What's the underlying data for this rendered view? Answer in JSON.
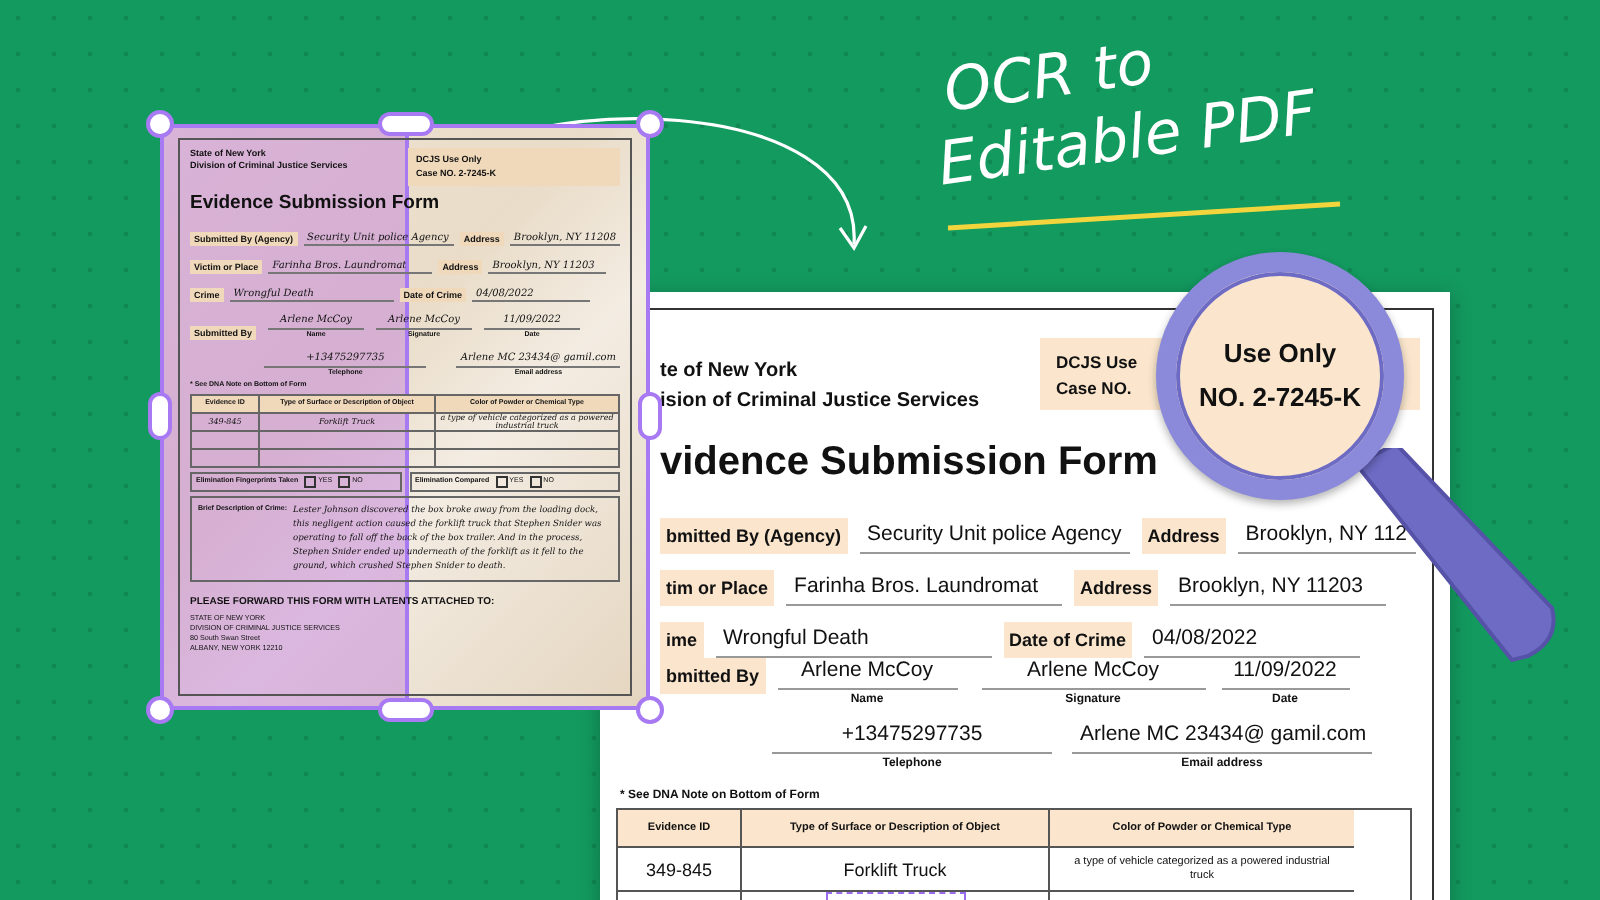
{
  "headline": {
    "lines": [
      "OCR to",
      "Editable PDF"
    ]
  },
  "scan": {
    "header_left": [
      "State of New York",
      "Division of Criminal Justice Services"
    ],
    "header_right": [
      "DCJS Use Only",
      "Case NO. 2-7245-K"
    ],
    "title": "Evidence Submission Form",
    "rows": [
      {
        "label": "Submitted By (Agency)",
        "value": "Security Unit police Agency",
        "label2": "Address",
        "value2": "Brooklyn, NY 11208"
      },
      {
        "label": "Victim or Place",
        "value": "Farinha Bros. Laundromat",
        "label2": "Address",
        "value2": "Brooklyn, NY 11203"
      },
      {
        "label": "Crime",
        "value": "Wrongful Death",
        "label2": "Date of Crime",
        "value2": "04/08/2022"
      }
    ],
    "submitted_label": "Submitted By",
    "signers": [
      {
        "value": "Arlene McCoy",
        "caption": "Name"
      },
      {
        "value": "Arlene McCoy",
        "caption": "Signature"
      },
      {
        "value": "11/09/2022",
        "caption": "Date"
      }
    ],
    "contacts": [
      {
        "value": "+13475297735",
        "caption": "Telephone"
      },
      {
        "value": "Arlene MC 23434@ gamil.com",
        "caption": "Email address"
      }
    ],
    "note": "* See DNA Note on Bottom of Form",
    "columns": [
      "Evidence ID",
      "Type of Surface or Description of Object",
      "Color of Powder or Chemical Type"
    ],
    "table_rows": [
      [
        "349-845",
        "Forklift Truck",
        "a type of vehicle categorized as a powered industrial truck"
      ]
    ],
    "eliminations": [
      {
        "label": "Elimination Fingerprints Taken",
        "options": [
          {
            "label": "YES",
            "checked": false
          },
          {
            "label": "NO",
            "checked": false
          }
        ]
      },
      {
        "label": "Elimination Compared",
        "options": [
          {
            "label": "YES",
            "checked": false
          },
          {
            "label": "NO",
            "checked": false
          }
        ]
      }
    ],
    "description_label": "Brief Description of Crime:",
    "description": "Lester Johnson discovered the box broke away from the loading dock, this negligent action caused the forklift truck that Stephen Snider was operating to fall off the back of the box trailer. And in the process, Stephen Snider ended up underneath of the forklift as it fell to the ground, which crushed Stephen Snider to death.",
    "forward": "PLEASE FORWARD THIS FORM WITH LATENTS ATTACHED TO:",
    "address_lines": [
      "STATE OF NEW YORK",
      "DIVISION OF CRIMINAL JUSTICE SERVICES",
      "80 South Swan Street",
      "ALBANY, NEW YORK 12210"
    ]
  },
  "document": {
    "header_left": [
      "te of New York",
      "ision of Criminal Justice Services"
    ],
    "header_right": [
      "DCJS Use",
      "Case NO."
    ],
    "title": "vidence Submission Form",
    "rows": [
      {
        "label": "bmitted By (Agency)",
        "value": "Security Unit police Agency",
        "label2": "Address",
        "value2": "Brooklyn, NY 112"
      },
      {
        "label": "tim or Place",
        "value": "Farinha Bros. Laundromat",
        "label2": "Address",
        "value2": "Brooklyn, NY 11203"
      },
      {
        "label": "ime",
        "value": "Wrongful Death",
        "label2": "Date of Crime",
        "value2": "04/08/2022"
      }
    ],
    "submitted_label": "bmitted By",
    "signers": [
      {
        "value": "Arlene McCoy",
        "caption": "Name"
      },
      {
        "value": "Arlene McCoy",
        "caption": "Signature"
      },
      {
        "value": "11/09/2022",
        "caption": "Date"
      }
    ],
    "contacts": [
      {
        "value": "+13475297735",
        "caption": "Telephone"
      },
      {
        "value": "Arlene MC 23434@ gamil.com",
        "caption": "Email address"
      }
    ],
    "note": "* See DNA Note on Bottom of Form",
    "columns": [
      "Evidence ID",
      "Type of Surface or Description of Object",
      "Color of Powder or Chemical Type"
    ],
    "table_rows": [
      [
        "349-845",
        "Forklift Truck",
        "a type of vehicle categorized as a powered industrial truck"
      ]
    ]
  },
  "magnifier": {
    "lines": [
      "Use Only",
      "NO. 2-7245-K"
    ]
  }
}
